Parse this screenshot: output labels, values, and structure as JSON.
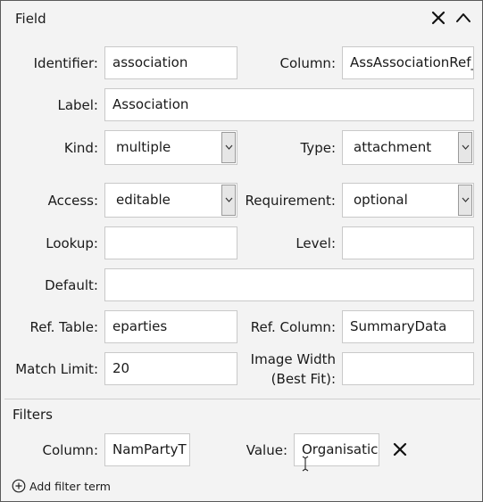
{
  "header": {
    "title": "Field"
  },
  "fields": {
    "identifier": {
      "label": "Identifier:",
      "value": "association"
    },
    "column": {
      "label": "Column:",
      "value": "AssAssociationRef_"
    },
    "label": {
      "label": "Label:",
      "value": "Association"
    },
    "kind": {
      "label": "Kind:",
      "value": "multiple"
    },
    "type": {
      "label": "Type:",
      "value": "attachment"
    },
    "access": {
      "label": "Access:",
      "value": "editable"
    },
    "requirement": {
      "label": "Requirement:",
      "value": "optional"
    },
    "lookup": {
      "label": "Lookup:",
      "value": ""
    },
    "level": {
      "label": "Level:",
      "value": ""
    },
    "default": {
      "label": "Default:",
      "value": ""
    },
    "ref_table": {
      "label": "Ref. Table:",
      "value": "eparties"
    },
    "ref_column": {
      "label": "Ref. Column:",
      "value": "SummaryData"
    },
    "match_limit": {
      "label": "Match Limit:",
      "value": "20"
    },
    "image_width": {
      "label_line1": "Image Width",
      "label_line2": "(Best Fit):",
      "value": ""
    }
  },
  "filters": {
    "title": "Filters",
    "terms": [
      {
        "column_label": "Column:",
        "column_value": "NamPartyT",
        "value_label": "Value:",
        "value_value": "Organisatic"
      }
    ],
    "add_label": "Add filter term"
  },
  "colors": {
    "panel_bg": "#f3f3f3",
    "input_bg": "#ffffff",
    "border": "#c9c9c9"
  }
}
